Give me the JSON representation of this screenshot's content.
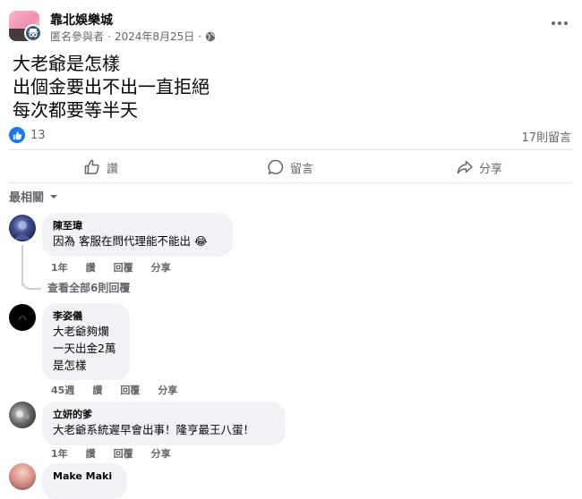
{
  "post": {
    "group_name": "靠北娛樂城",
    "author": "匿名參與者",
    "separator": "·",
    "date": "2024年8月25日",
    "audience_icon": "globe-icon",
    "more_icon": "more-horizontal-icon",
    "lines": [
      "大老爺是怎樣",
      "出個金要出不出一直拒絕",
      "每次都要等半天"
    ],
    "like_count": "13",
    "comments_count": "17則留言"
  },
  "actions": {
    "like": "讚",
    "comment": "留言",
    "share": "分享"
  },
  "sort": {
    "label": "最相關"
  },
  "comments": [
    {
      "name": "陳至瑋",
      "text": "因為 客服在問代理能不能出 😂",
      "time": "1年",
      "like": "讚",
      "reply": "回覆",
      "share": "分享",
      "view_replies": "查看全部6則回覆"
    },
    {
      "name": "李姿儀",
      "lines": [
        "大老爺夠爛",
        "一天出金2萬",
        "是怎樣"
      ],
      "time": "45週",
      "like": "讚",
      "reply": "回覆",
      "share": "分享"
    },
    {
      "name": "立妍的爹",
      "text": "大老爺系統遲早會出事！隆亨最王八蛋！",
      "time": "1年",
      "like": "讚",
      "reply": "回覆",
      "share": "分享"
    },
    {
      "name": "Make Maki"
    }
  ],
  "colors": {
    "accent": "#1877f2",
    "secondary_text": "#65676b",
    "bubble": "#f0f2f5"
  }
}
